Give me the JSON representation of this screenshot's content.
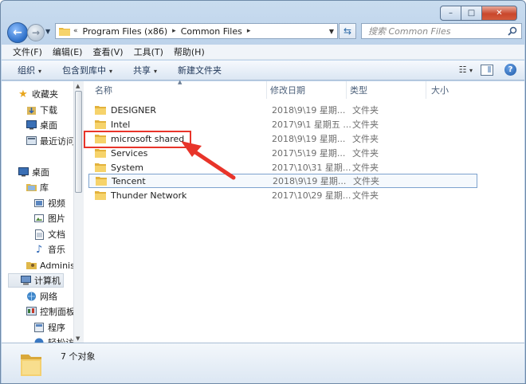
{
  "window": {
    "controls": {
      "minimize": "–",
      "maximize": "□",
      "close": "✕"
    }
  },
  "address_bar": {
    "overflow": "«",
    "crumbs": [
      "Program Files (x86)",
      "Common Files"
    ],
    "separator": "▸"
  },
  "search": {
    "placeholder": "搜索 Common Files"
  },
  "menu": [
    "文件(F)",
    "编辑(E)",
    "查看(V)",
    "工具(T)",
    "帮助(H)"
  ],
  "toolbar": {
    "organize": "组织",
    "include_in_library": "包含到库中",
    "share": "共享",
    "new_folder": "新建文件夹",
    "dropdown_arrow": "▾",
    "view_icon": "☷",
    "help": "?"
  },
  "nav_pane": {
    "favorites": {
      "label": "收藏夹",
      "items": [
        "下载",
        "桌面",
        "最近访问"
      ]
    },
    "desktop": {
      "label": "桌面"
    },
    "library": {
      "label": "库",
      "items": [
        "视频",
        "图片",
        "文档",
        "音乐"
      ]
    },
    "user": "Adminis",
    "computer": "计算机",
    "network": "网络",
    "control_panel": "控制面板",
    "programs": "程序",
    "more": "轻松访"
  },
  "columns": {
    "name": "名称",
    "date": "修改日期",
    "type": "类型",
    "size": "大小"
  },
  "files": [
    {
      "name": "DESIGNER",
      "date": "2018\\9\\19 星期...",
      "type": "文件夹"
    },
    {
      "name": "Intel",
      "date": "2017\\9\\1 星期五 ...",
      "type": "文件夹"
    },
    {
      "name": "microsoft shared",
      "date": "2018\\9\\19 星期...",
      "type": "文件夹"
    },
    {
      "name": "Services",
      "date": "2017\\5\\19 星期...",
      "type": "文件夹"
    },
    {
      "name": "System",
      "date": "2017\\10\\31 星期...",
      "type": "文件夹"
    },
    {
      "name": "Tencent",
      "date": "2018\\9\\19 星期...",
      "type": "文件夹"
    },
    {
      "name": "Thunder Network",
      "date": "2017\\10\\29 星期...",
      "type": "文件夹"
    }
  ],
  "status": {
    "count": "7 个对象"
  },
  "colors": {
    "annotation": "#e8342a",
    "folder": "#f2c94c",
    "highlight_border": "#7da2ce"
  }
}
